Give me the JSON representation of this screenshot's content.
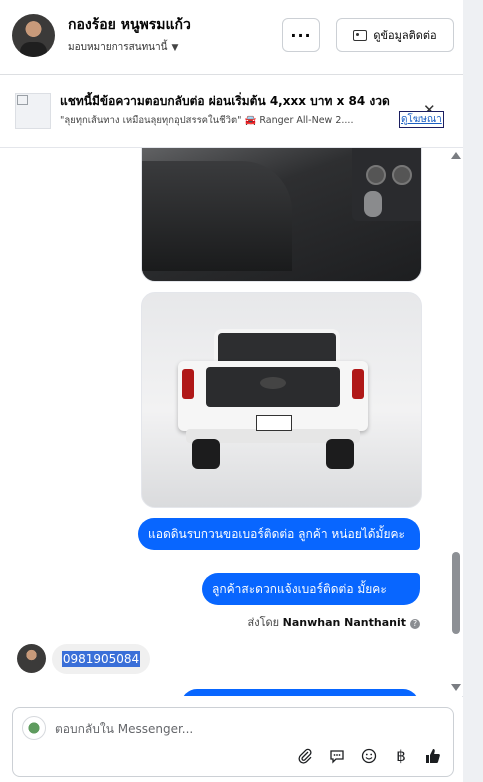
{
  "header": {
    "contact_name": "กองร้อย หนูพรมแก้ว",
    "assignee_label": "มอบหมายการสนทนานี้",
    "more_label": "···",
    "contact_info_label": "ดูข้อมูลติดต่อ"
  },
  "ad": {
    "title": "แชทนี้มีข้อความตอบกลับต่อ ผ่อนเริ่มต้น 4,xxx บาท x 84 งวด",
    "subtitle": "\"ลุยทุกเส้นทาง เหมือนลุยทุกอุปสรรคในชีวิต\" 🚘 Ranger All-New 2....",
    "link_label": "ดูโฆษณา",
    "close_label": "✕"
  },
  "messages": {
    "outgoing_1": "แอดดินรบกวนขอเบอร์ติดต่อ ลูกค้า  หน่อยได้มั้ยคะ",
    "outgoing_2": "ลูกค้าสะดวกแจ้งเบอร์ติดต่อ มั้ยคะ",
    "sent_by_prefix": "ส่งโดย",
    "sent_by_name": "Nanwhan Nanthanit",
    "incoming_phone": "0981905084"
  },
  "composer": {
    "placeholder": "ตอบกลับใน Messenger..."
  },
  "icons": [
    "card-icon",
    "chevron-down-icon",
    "close-icon",
    "help-icon",
    "attach-icon",
    "saved-replies-icon",
    "emoji-icon",
    "baht-icon",
    "like-icon"
  ],
  "colors": {
    "accent": "#0866ff",
    "background": "#ffffff"
  }
}
